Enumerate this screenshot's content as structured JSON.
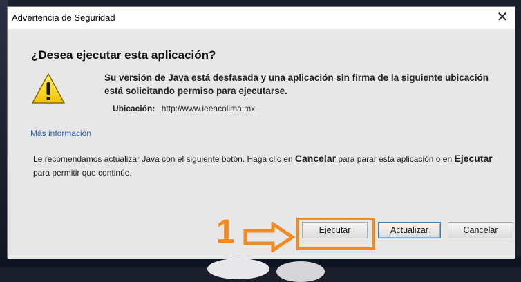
{
  "window": {
    "title": "Advertencia de Seguridad",
    "close_symbol": "✕"
  },
  "dialog": {
    "heading": "¿Desea ejecutar esta aplicación?",
    "message": "Su versión de Java está desfasada y una aplicación sin firma de la siguiente ubicación está solicitando permiso para ejecutarse.",
    "location_label": "Ubicación:",
    "location_value": "http://www.ieeacolima.mx",
    "more_info": "Más información",
    "recommend_part1": "Le recomendamos actualizar Java con el siguiente botón. Haga clic en ",
    "recommend_bold1": "Cancelar",
    "recommend_part2": " para parar esta aplicación o en ",
    "recommend_bold2": "Ejecutar",
    "recommend_part3": " para permitir que continúe."
  },
  "buttons": {
    "run": "Ejecutar",
    "update": "Actualizar",
    "cancel": "Cancelar"
  },
  "annotation": {
    "step_number": "1",
    "color": "#f28a22"
  },
  "icons": {
    "warning": "warning-triangle-icon",
    "arrow": "arrow-right-icon"
  }
}
